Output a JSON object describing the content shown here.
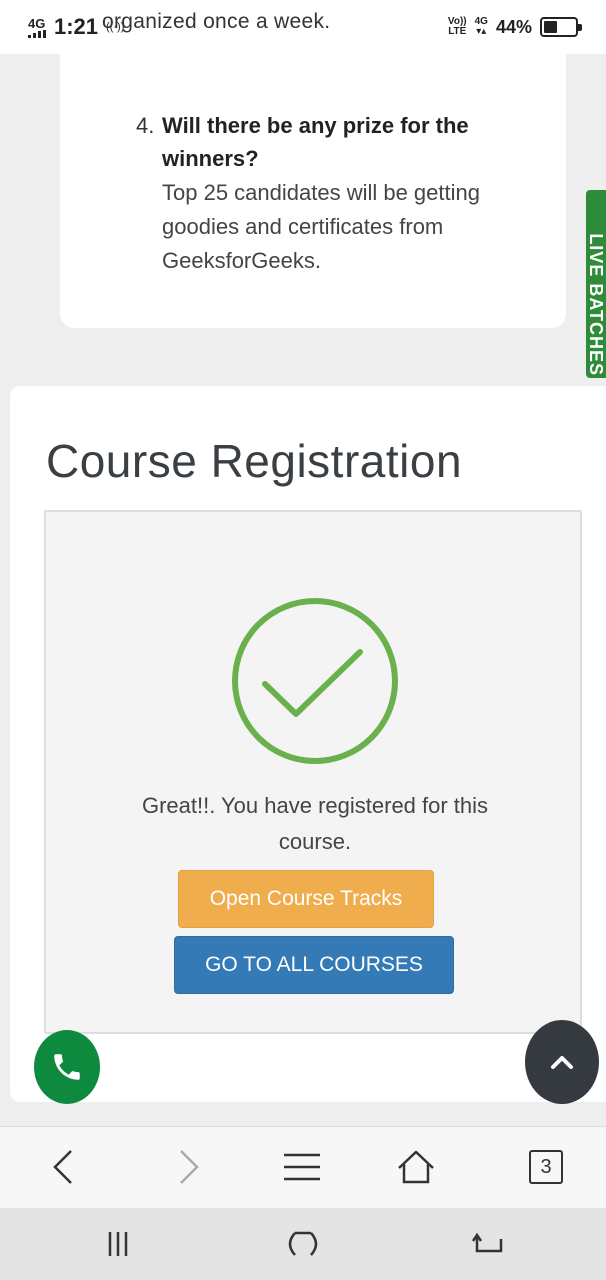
{
  "status_bar": {
    "network": "4G",
    "time": "1:21",
    "hotspot": "((·))",
    "volte_top": "Vo))",
    "volte_bottom": "LTE",
    "network_right": "4G",
    "battery_percent": "44%"
  },
  "faq": {
    "previous_answer_tail": "organized once a week.",
    "item_number": "4.",
    "question": "Will there be any prize for the winners?",
    "answer": "Top 25 candidates will be getting goodies and certificates from GeeksforGeeks."
  },
  "side_tab": {
    "label": "LIVE BATCHES"
  },
  "registration": {
    "title": "Course Registration",
    "message": "Great!!. You have registered for this course.",
    "open_tracks_label": "Open Course Tracks",
    "all_courses_label": "GO TO ALL COURSES"
  },
  "browser_toolbar": {
    "tab_count": "3"
  },
  "colors": {
    "success_green": "#6ab04c",
    "warning_orange": "#f0ad4e",
    "primary_blue": "#337ab7",
    "phone_green": "#0e8a3e",
    "side_tab_green": "#2e8b3a",
    "dark_button": "#343a40"
  },
  "icons": {
    "back": "chevron-left-icon",
    "forward": "chevron-right-icon",
    "menu": "hamburger-menu-icon",
    "home": "home-icon",
    "tabs": "tabs-count-icon",
    "phone": "phone-icon",
    "scroll_top": "chevron-up-icon",
    "check": "check-circle-icon"
  }
}
